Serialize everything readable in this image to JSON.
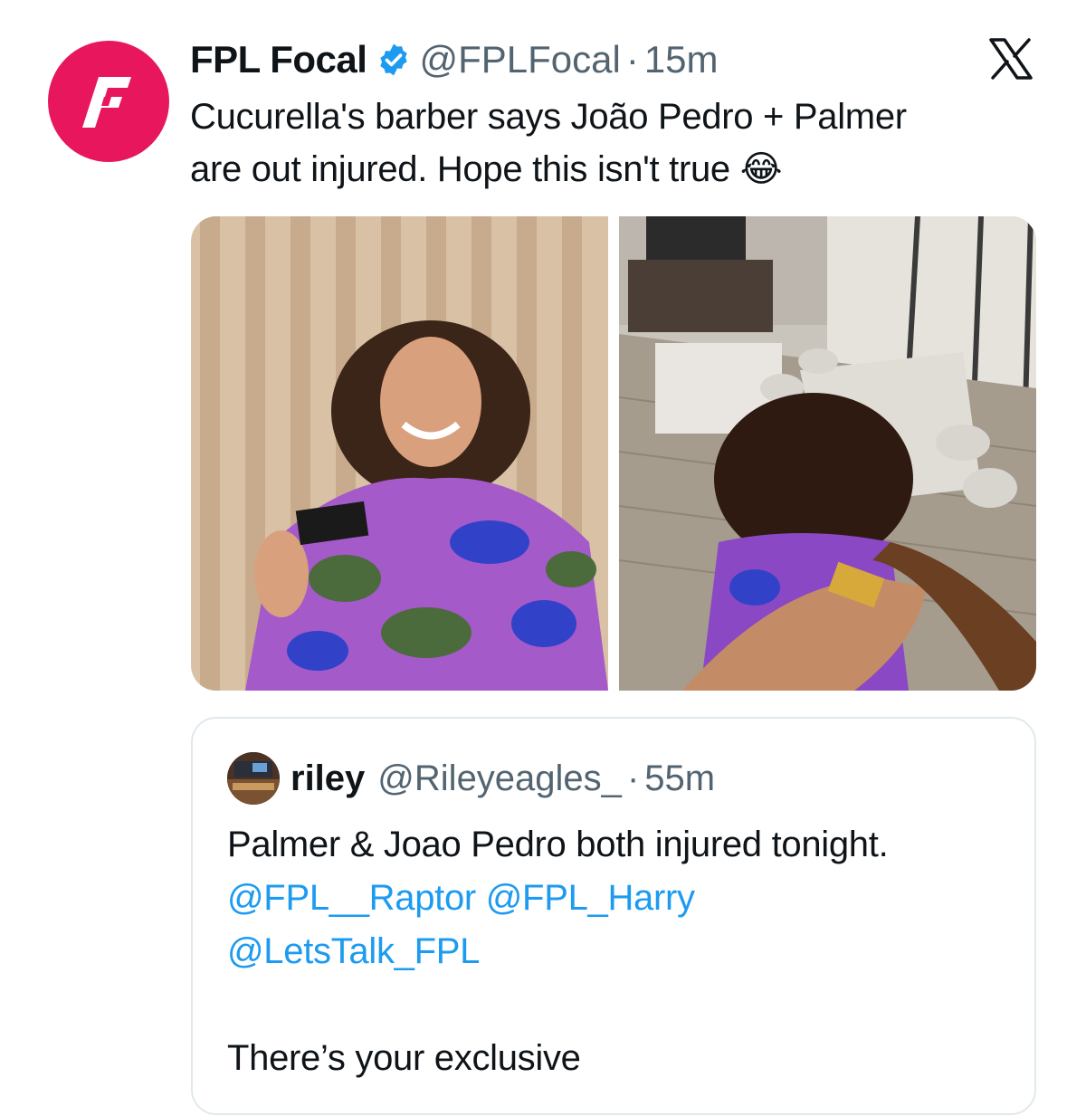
{
  "tweet": {
    "author_name": "FPL Focal",
    "handle": "@FPLFocal",
    "separator": "·",
    "time": "15m",
    "text_line_1": "Cucurella's barber says João Pedro + Palmer",
    "text_line_2": "are out injured. Hope this isn't true",
    "emoji": "😂",
    "brand_color": "#e8175d"
  },
  "icons": {
    "avatar": "fpl-focal-logo",
    "verified": "verified-badge-icon",
    "platform": "x-logo-icon"
  },
  "quote": {
    "author_name": "riley",
    "handle": "@Rileyeagles_",
    "separator": "·",
    "time": "55m",
    "line_1": "Palmer & Joao Pedro both injured tonight.",
    "mention_1": "@FPL__Raptor",
    "mention_2": "@FPL_Harry",
    "mention_3": "@LetsTalk_FPL",
    "line_last": "There’s your exclusive",
    "link_color": "#1d9bf0"
  }
}
